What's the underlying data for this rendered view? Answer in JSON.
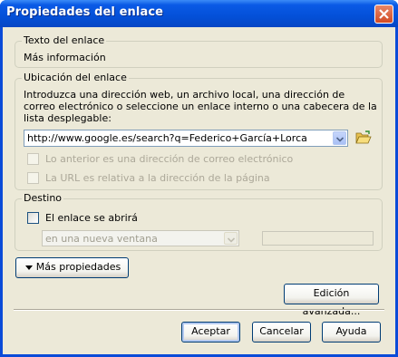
{
  "window": {
    "title": "Propiedades del enlace"
  },
  "link_text": {
    "legend": "Texto del enlace",
    "value": "Más información"
  },
  "location": {
    "legend": "Ubicación del enlace",
    "description": "Introduzca una dirección web, un archivo local, una dirección de correo electrónico o seleccione un enlace interno o una cabecera de la lista desplegable:",
    "url": "http://www.google.es/search?q=Federico+García+Lorca",
    "email_checkbox": "Lo anterior es una dirección de correo electrónico",
    "relative_checkbox": "La URL es relativa a la dirección de la página"
  },
  "destination": {
    "legend": "Destino",
    "open_checkbox": "El enlace se abrirá",
    "target_select": "en una nueva ventana"
  },
  "buttons": {
    "more_properties": "Más propiedades",
    "advanced_edit": "Edición avanzada...",
    "accept": "Aceptar",
    "cancel": "Cancelar",
    "help": "Ayuda"
  },
  "icons": {
    "close": "close-icon",
    "folder": "folder-open-icon",
    "dropdown": "chevron-down-icon",
    "expand": "triangle-down-icon"
  }
}
